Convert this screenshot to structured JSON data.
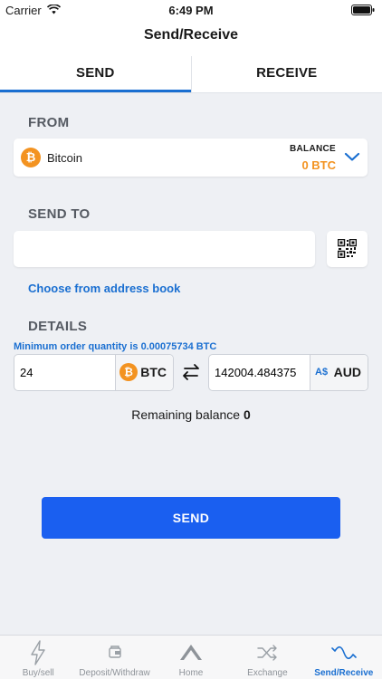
{
  "status_bar": {
    "carrier": "Carrier",
    "time": "6:49 PM"
  },
  "header": {
    "title": "Send/Receive"
  },
  "tabs": [
    {
      "label": "SEND",
      "active": true
    },
    {
      "label": "RECEIVE",
      "active": false
    }
  ],
  "from": {
    "label": "FROM",
    "currency_symbol": "₿",
    "currency_name": "Bitcoin",
    "balance_label": "BALANCE",
    "balance_value": "0 BTC"
  },
  "send_to": {
    "label": "SEND TO",
    "address_value": "",
    "address_placeholder": "",
    "address_book_link": "Choose from address book"
  },
  "details": {
    "label": "DETAILS",
    "min_order": "Minimum order quantity is 0.00075734 BTC",
    "btc_amount": "24",
    "btc_code": "BTC",
    "btc_symbol": "₿",
    "aud_amount": "142004.484375",
    "aud_symbol": "A$",
    "aud_code": "AUD",
    "remaining_label": "Remaining balance",
    "remaining_value": "0"
  },
  "send_button": {
    "label": "SEND"
  },
  "tab_bar": [
    {
      "label": "Buy/sell",
      "icon": "lightning-icon"
    },
    {
      "label": "Deposit/Withdraw",
      "icon": "wallet-icon"
    },
    {
      "label": "Home",
      "icon": "home-chevron-icon"
    },
    {
      "label": "Exchange",
      "icon": "shuffle-icon"
    },
    {
      "label": "Send/Receive",
      "icon": "wave-icon",
      "active": true
    }
  ],
  "colors": {
    "accent": "#1a6fd1",
    "bitcoin": "#f39321",
    "send_button": "#1a5ff0"
  }
}
